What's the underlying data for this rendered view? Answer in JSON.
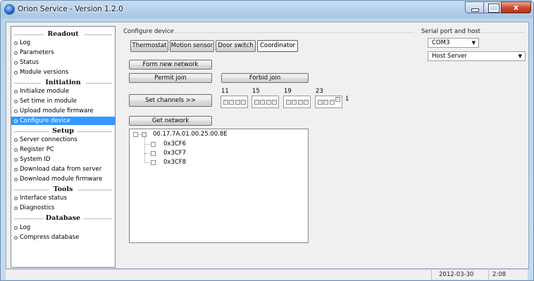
{
  "window": {
    "title": "Orion Service - Version 1.2.0",
    "close_glyph": "x"
  },
  "sidebar": {
    "sections": [
      {
        "title": "Readout",
        "items": [
          "Log",
          "Parameters",
          "Status",
          "Module versions"
        ]
      },
      {
        "title": "Initiation",
        "items": [
          "Initialize module",
          "Set time in module",
          "Upload module firmware",
          "Configure device"
        ]
      },
      {
        "title": "Setup",
        "items": [
          "Server connections",
          "Register PC",
          "System ID",
          "Download data from server",
          "Download module firmware"
        ]
      },
      {
        "title": "Tools",
        "items": [
          "Interface status",
          "Diagnostics"
        ]
      },
      {
        "title": "Database",
        "items": [
          "Log",
          "Compress database"
        ]
      }
    ],
    "selected": "Configure device"
  },
  "configure": {
    "group_label": "Configure device",
    "tabs": [
      "Thermostat",
      "Motion sensor",
      "Door switch",
      "Coordinator"
    ],
    "active_tab": "Coordinator",
    "form_network": "Form new network",
    "permit_join": "Permit join",
    "forbid_join": "Forbid join",
    "set_channels": "Set channels  >>",
    "channel_labels": [
      "11",
      "15",
      "19",
      "23"
    ],
    "channel_end_label": "1",
    "get_network": "Get network"
  },
  "tree": {
    "root": "00.17.7A.01.00.25.00.8E",
    "children": [
      "0x3CF6",
      "0x3CF7",
      "0x3CF8"
    ]
  },
  "serial": {
    "group_label": "Serial port and host",
    "port": "COM3",
    "host": "Host Server"
  },
  "status": {
    "date": "2012-03-30",
    "time": "2:08"
  }
}
